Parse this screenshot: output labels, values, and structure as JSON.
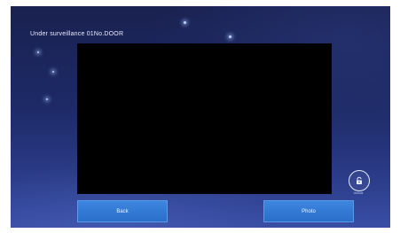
{
  "screen": {
    "title": "Under surveillance 01No.DOOR"
  },
  "buttons": {
    "back_label": "Back",
    "photo_label": "Photo"
  },
  "unlock": {
    "label": "Unlock",
    "icon": "lock-icon"
  },
  "colors": {
    "button": "#2f77d2",
    "background_dark": "#1a2150",
    "background_light": "#3a4ea4",
    "video": "#000000"
  }
}
